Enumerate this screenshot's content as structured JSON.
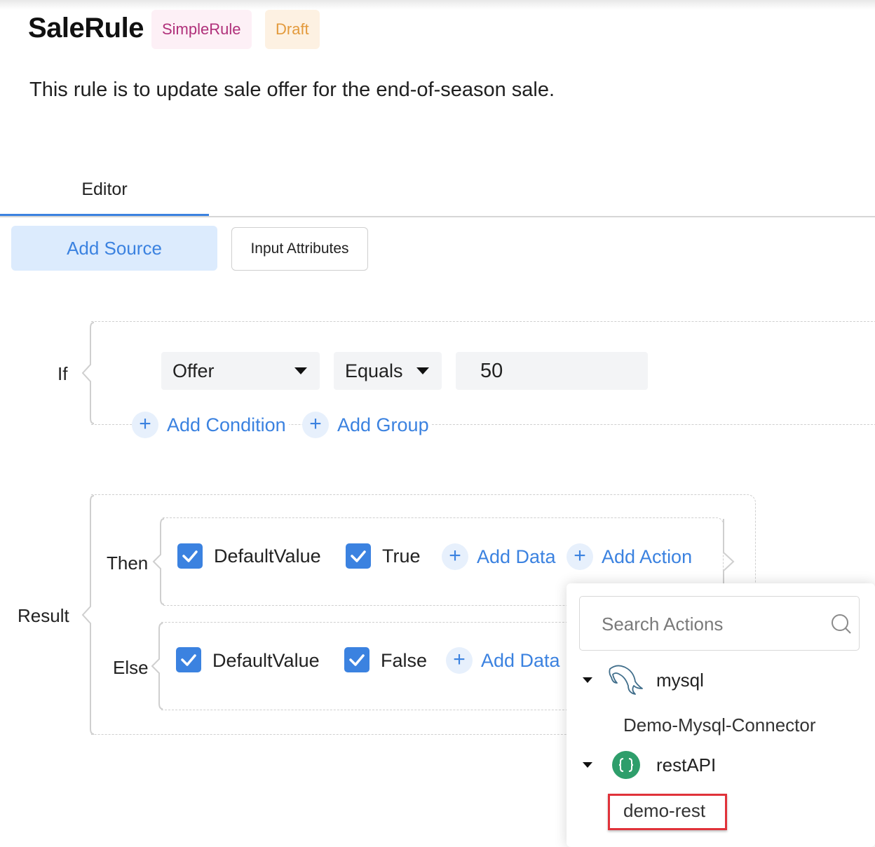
{
  "header": {
    "title": "SaleRule",
    "type_badge": "SimpleRule",
    "status_badge": "Draft",
    "description": "This rule is to update sale offer for the end-of-season sale."
  },
  "tabs": [
    {
      "label": "Editor",
      "active": true
    }
  ],
  "toolbar": {
    "add_source_label": "Add Source",
    "input_attributes_label": "Input Attributes"
  },
  "if_block": {
    "label": "If",
    "condition": {
      "attribute": "Offer",
      "operator": "Equals",
      "value": "50"
    },
    "add_condition_label": "Add Condition",
    "add_group_label": "Add Group"
  },
  "result_block": {
    "label": "Result",
    "then": {
      "label": "Then",
      "items": [
        {
          "label": "DefaultValue",
          "checked": true
        },
        {
          "label": "True",
          "checked": true
        }
      ],
      "add_data_label": "Add Data",
      "add_action_label": "Add Action"
    },
    "else": {
      "label": "Else",
      "items": [
        {
          "label": "DefaultValue",
          "checked": true
        },
        {
          "label": "False",
          "checked": true
        }
      ],
      "add_data_label": "Add Data"
    }
  },
  "actions_popup": {
    "search_placeholder": "Search Actions",
    "groups": [
      {
        "label": "mysql",
        "icon": "mysql-dolphin-icon",
        "expanded": true,
        "children": [
          "Demo-Mysql-Connector"
        ]
      },
      {
        "label": "restAPI",
        "icon": "rest-api-icon",
        "expanded": true,
        "children": [
          "demo-rest"
        ]
      }
    ],
    "highlighted_item": "demo-rest"
  },
  "colors": {
    "accent": "#3b82e0",
    "accent_light": "#dcebfd",
    "type_badge_text": "#b0307a",
    "status_badge_text": "#e39a3c",
    "highlight_border": "#e0323a",
    "rest_icon": "#2e9e6b"
  }
}
